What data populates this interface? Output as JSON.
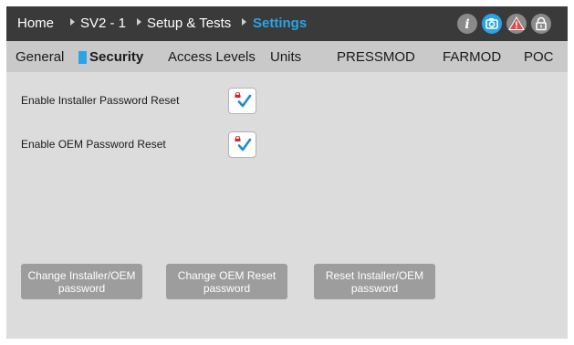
{
  "breadcrumb": {
    "items": [
      "Home",
      "SV2 - 1",
      "Setup & Tests",
      "Settings"
    ]
  },
  "header_icons": [
    "info-icon",
    "camera-icon",
    "warning-icon",
    "lock-icon"
  ],
  "colors": {
    "accent": "#2aa4e6",
    "warning": "#e04a4a",
    "header_bg": "#3a3a3a",
    "button_disabled": "#9d9d9d"
  },
  "tabs": {
    "active": "Security",
    "items": [
      "General",
      "Security",
      "Access Levels",
      "Units",
      "PRESSMOD",
      "FARMOD",
      "POC"
    ]
  },
  "settings": [
    {
      "label": "Enable Installer Password Reset",
      "checked": true
    },
    {
      "label": "Enable OEM Password Reset",
      "checked": true
    }
  ],
  "buttons": [
    {
      "label": "Change Installer/OEM password"
    },
    {
      "label": "Change OEM Reset password"
    },
    {
      "label": "Reset Installer/OEM password"
    }
  ]
}
